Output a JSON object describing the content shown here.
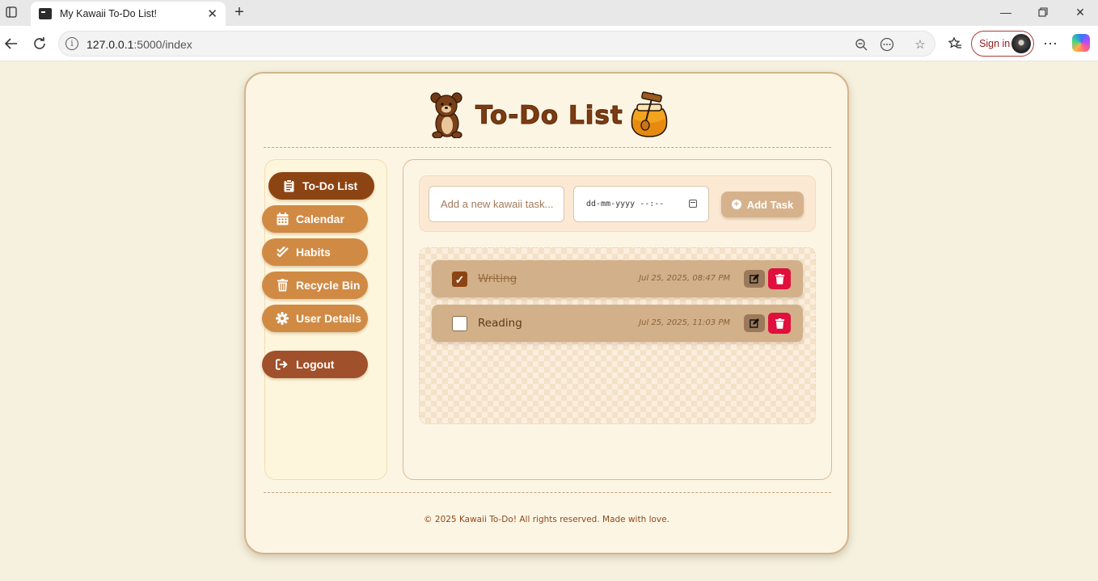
{
  "browser": {
    "tab_title": "My Kawaii To-Do List!",
    "url_host": "127.0.0.1",
    "url_path": ":5000/index",
    "signin_label": "Sign in"
  },
  "header": {
    "title": "To-Do List"
  },
  "sidebar": {
    "items": [
      {
        "label": "To-Do List",
        "icon": "clipboard-icon",
        "active": true
      },
      {
        "label": "Calendar",
        "icon": "calendar-icon"
      },
      {
        "label": "Habits",
        "icon": "double-check-icon"
      },
      {
        "label": "Recycle Bin",
        "icon": "trash-icon"
      },
      {
        "label": "User Details",
        "icon": "gear-icon"
      }
    ],
    "logout_label": "Logout"
  },
  "add_task": {
    "placeholder": "Add a new kawaii task...",
    "date_placeholder": "dd-mm-yyyy --:--",
    "button_label": "Add Task"
  },
  "tasks": [
    {
      "name": "Writing",
      "date": "Jul 25, 2025, 08:47 PM",
      "done": true
    },
    {
      "name": "Reading",
      "date": "Jul 25, 2025, 11:03 PM",
      "done": false
    }
  ],
  "footer": {
    "text": "© 2025 Kawaii To-Do! All rights reserved. Made with love."
  },
  "colors": {
    "brand_brown": "#8d4413",
    "nav_orange": "#d08a44",
    "delete_red": "#e0103d",
    "page_bg": "#f5f1de"
  }
}
